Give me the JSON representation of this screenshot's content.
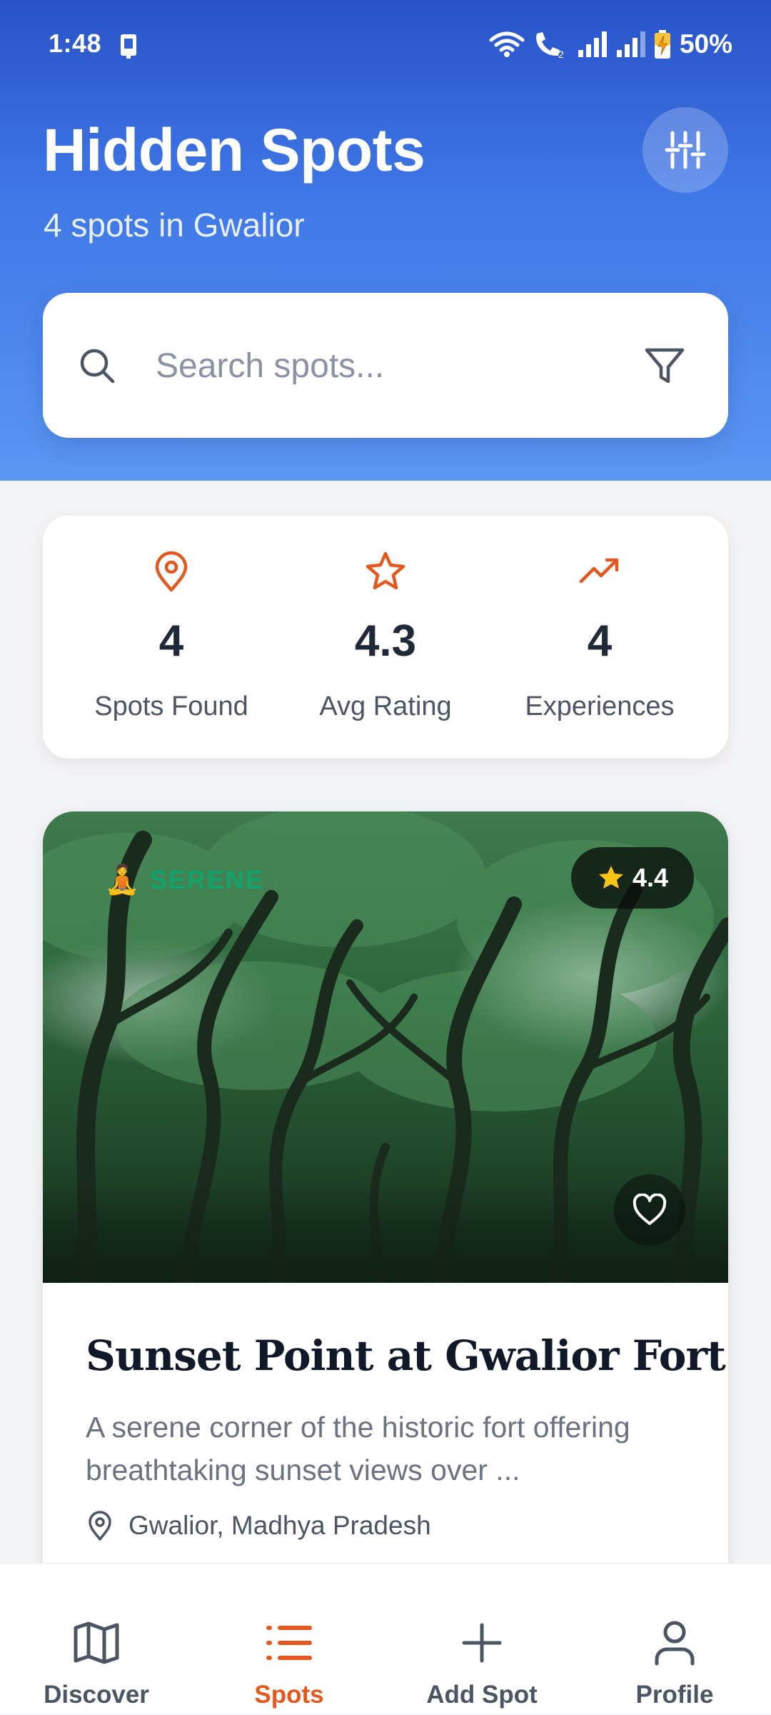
{
  "status_bar": {
    "time": "1:48",
    "battery": "50%",
    "sim_label": "2"
  },
  "header": {
    "title": "Hidden Spots",
    "subtitle": "4 spots in Gwalior",
    "settings_icon": "sliders-icon"
  },
  "search": {
    "placeholder": "Search spots...",
    "value": ""
  },
  "stats": [
    {
      "icon": "map-pin-icon",
      "value": "4",
      "label": "Spots Found"
    },
    {
      "icon": "star-outline-icon",
      "value": "4.3",
      "label": "Avg Rating"
    },
    {
      "icon": "trending-up-icon",
      "value": "4",
      "label": "Experiences"
    }
  ],
  "spot": {
    "category": "SERENE",
    "category_emoji": "🧘",
    "rating": "4.4",
    "title": "Sunset Point at Gwalior Fort",
    "description": "A serene corner of the historic fort offering breathtaking sunset views over ...",
    "location": "Gwalior, Madhya Pradesh"
  },
  "nav": [
    {
      "label": "Discover",
      "icon": "map-icon",
      "active": false
    },
    {
      "label": "Spots",
      "icon": "list-icon",
      "active": true
    },
    {
      "label": "Add Spot",
      "icon": "plus-icon",
      "active": false
    },
    {
      "label": "Profile",
      "icon": "user-icon",
      "active": false
    }
  ],
  "colors": {
    "accent": "#e2581f",
    "header_top": "#2952c8",
    "header_bottom": "#5b97f3",
    "serene_green": "#10a36b",
    "star_yellow": "#f5c518"
  }
}
